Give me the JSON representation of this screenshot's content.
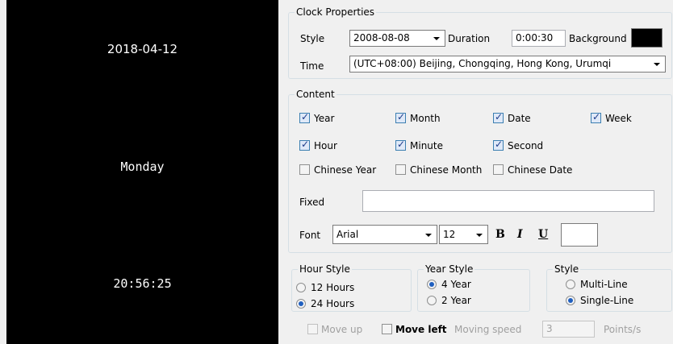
{
  "preview": {
    "date": "2018-04-12",
    "week": "Monday",
    "time": "20:56:25"
  },
  "clock_properties": {
    "legend": "Clock Properties",
    "style_label": "Style",
    "style_value": "2008-08-08",
    "duration_label": "Duration",
    "duration_value": "0:00:30",
    "background_label": "Background",
    "background_color": "#000000",
    "time_label": "Time",
    "time_value": "(UTC+08:00) Beijing, Chongqing, Hong Kong, Urumqi"
  },
  "content": {
    "legend": "Content",
    "checks": {
      "year": {
        "label": "Year",
        "checked": true
      },
      "month": {
        "label": "Month",
        "checked": true
      },
      "date": {
        "label": "Date",
        "checked": true
      },
      "week": {
        "label": "Week",
        "checked": true
      },
      "hour": {
        "label": "Hour",
        "checked": true
      },
      "minute": {
        "label": "Minute",
        "checked": true
      },
      "second": {
        "label": "Second",
        "checked": true
      },
      "chinese_year": {
        "label": "Chinese Year",
        "checked": false
      },
      "chinese_month": {
        "label": "Chinese Month",
        "checked": false
      },
      "chinese_date": {
        "label": "Chinese Date",
        "checked": false
      }
    },
    "fixed_label": "Fixed",
    "fixed_value": "",
    "font_label": "Font",
    "font_value": "Arial",
    "size_value": "12",
    "bold": "B",
    "italic": "I",
    "underline": "U",
    "font_color": "#ffffff"
  },
  "hour_style": {
    "legend": "Hour Style",
    "opt12": "12 Hours",
    "opt24": "24 Hours",
    "selected": "24 Hours"
  },
  "year_style": {
    "legend": "Year Style",
    "opt4": "4 Year",
    "opt2": "2 Year",
    "selected": "4 Year"
  },
  "style": {
    "legend": "Style",
    "multi": "Multi-Line",
    "single": "Single-Line",
    "selected": "Single-Line"
  },
  "moving": {
    "move_up": "Move up",
    "move_left": "Move left",
    "speed_label": "Moving speed",
    "speed_value": "3",
    "unit": "Points/s"
  }
}
